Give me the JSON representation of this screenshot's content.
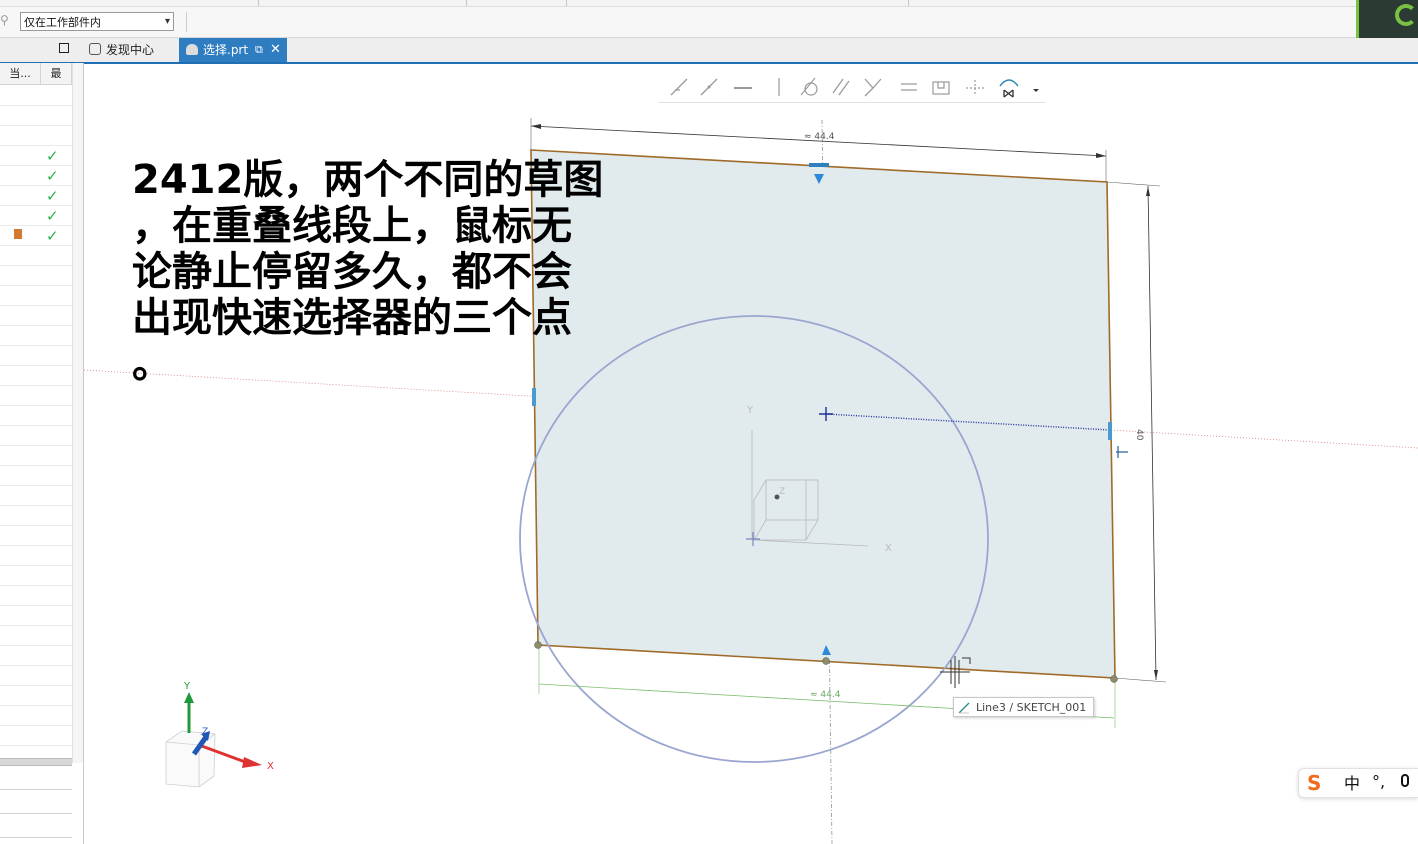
{
  "filter": {
    "selection_scope": "仅在工作部件内"
  },
  "tabs": [
    {
      "label": "发现中心",
      "icon": "home-icon",
      "active": false
    },
    {
      "label": "选择.prt",
      "icon": "part-icon",
      "active": true,
      "close": "✕"
    }
  ],
  "left_panel": {
    "columns": [
      "当...",
      "最"
    ],
    "checked_rows": 5
  },
  "sketch": {
    "dimension_top": "≈ 44.4",
    "dimension_bottom": "≈ 44.4",
    "dimension_right": "40",
    "axis_x": "X",
    "axis_y": "Y",
    "axis_z": "Z"
  },
  "triad": {
    "x": "X",
    "y": "Y",
    "z": "Z"
  },
  "annotation": {
    "lines": [
      "2412版，两个不同的草图",
      "，在重叠线段上，鼠标无",
      "论静止停留多久，都不会",
      "出现快速选择器的三个点",
      "。"
    ]
  },
  "tooltip": {
    "text": "Line3 / SKETCH_001",
    "icon": "line-icon"
  },
  "ime": {
    "lang": "中",
    "punct": "°,"
  },
  "colors": {
    "tab_active": "#2f7dc1",
    "sketch_fill": "#e1ebee",
    "sketch_edge": "#a06a28",
    "circle": "#9aa6cf",
    "check": "#29b34a"
  }
}
